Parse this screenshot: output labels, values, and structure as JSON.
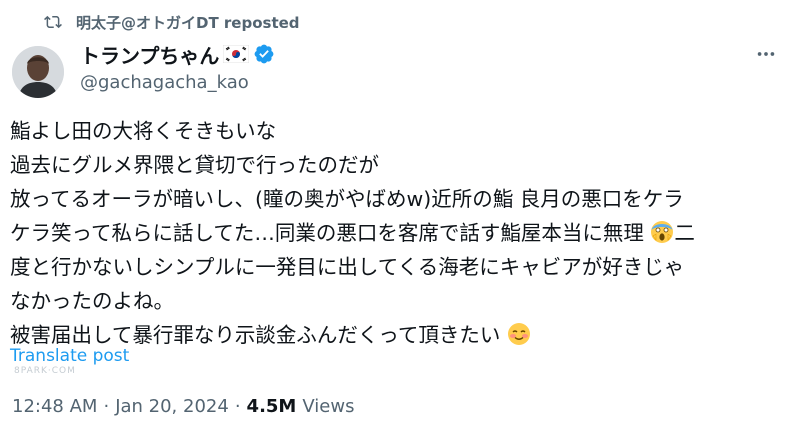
{
  "repost": {
    "icon": "repost-icon",
    "text": "明太子@オトガイDT reposted"
  },
  "author": {
    "display_name": "トランプちゃん",
    "flag_icon": "south-korea-flag-icon",
    "verified_icon": "verified-badge-icon",
    "handle": "@gachagacha_kao",
    "avatar_icon": "avatar"
  },
  "more_icon": "more-options-icon",
  "post": {
    "lines": [
      "鮨よし田の大将くそきもいな",
      "過去にグルメ界隈と貸切で行ったのだが",
      "放ってるオーラが暗いし、(瞳の奥がやばめw)近所の鮨 良月の悪口をケラ",
      "ケラ笑って私らに話してた…同業の悪口を客席で話す鮨屋本当に無理",
      "度と行かないしシンプルに一発目に出してくる海老にキャビアが好きじゃ",
      "なかったのよね。",
      "被害届出して暴行罪なり示談金ふんだくって頂きたい"
    ],
    "line4_tail": "二",
    "emoji_scream": "screaming-face-emoji",
    "emoji_blush": "smiling-face-emoji"
  },
  "translate_label": "Translate post",
  "watermark": "8PARK·COM",
  "meta": {
    "time": "12:48 AM",
    "separator1": "·",
    "date": "Jan 20, 2024",
    "separator2": "·",
    "views_count": "4.5M",
    "views_label": "Views"
  },
  "colors": {
    "text": "#0f1419",
    "secondary": "#536471",
    "link": "#1d9bf0",
    "verified": "#1d9bf0"
  }
}
